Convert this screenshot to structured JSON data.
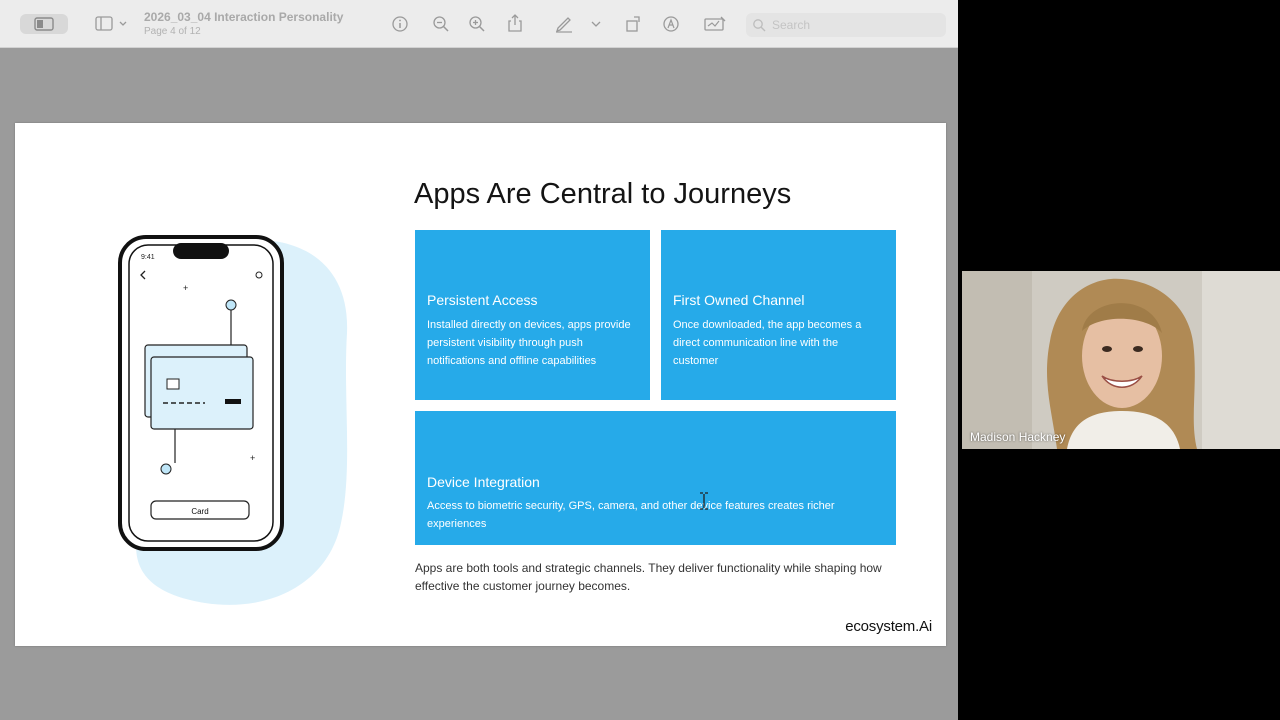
{
  "viewer": {
    "title": "2026_03_04 Interaction Personality",
    "page_indicator": "Page 4 of 12",
    "search_placeholder": "Search",
    "toolbar_icons": [
      "sidebar-icon",
      "chevron-down-icon",
      "info-icon",
      "zoom-out-icon",
      "zoom-in-icon",
      "share-icon",
      "markup-pen-icon",
      "chevron-down-icon",
      "rotate-icon",
      "highlight-icon",
      "signature-icon",
      "search-icon"
    ]
  },
  "slide": {
    "title": "Apps Are Central to Journeys",
    "cards": [
      {
        "title": "Persistent Access",
        "body": "Installed directly on devices, apps provide persistent visibility through push notifications and offline capabilities"
      },
      {
        "title": "First Owned Channel",
        "body": "Once downloaded, the app becomes a direct communication line with the customer"
      },
      {
        "title": "Device Integration",
        "body": "Access to biometric security, GPS, camera, and other device features creates richer experiences"
      }
    ],
    "summary": "Apps are both tools and strategic channels. They deliver functionality while shaping how effective the customer journey becomes.",
    "brand": "ecosystem.Ai",
    "illustration": {
      "phone_time": "9:41",
      "phone_button_label": "Card"
    }
  },
  "call": {
    "participant_name": "Madison Hackney"
  },
  "colors": {
    "card_blue": "#26aae9",
    "viewer_gray": "#9b9b9b",
    "toolbar_bg": "#ececec"
  }
}
